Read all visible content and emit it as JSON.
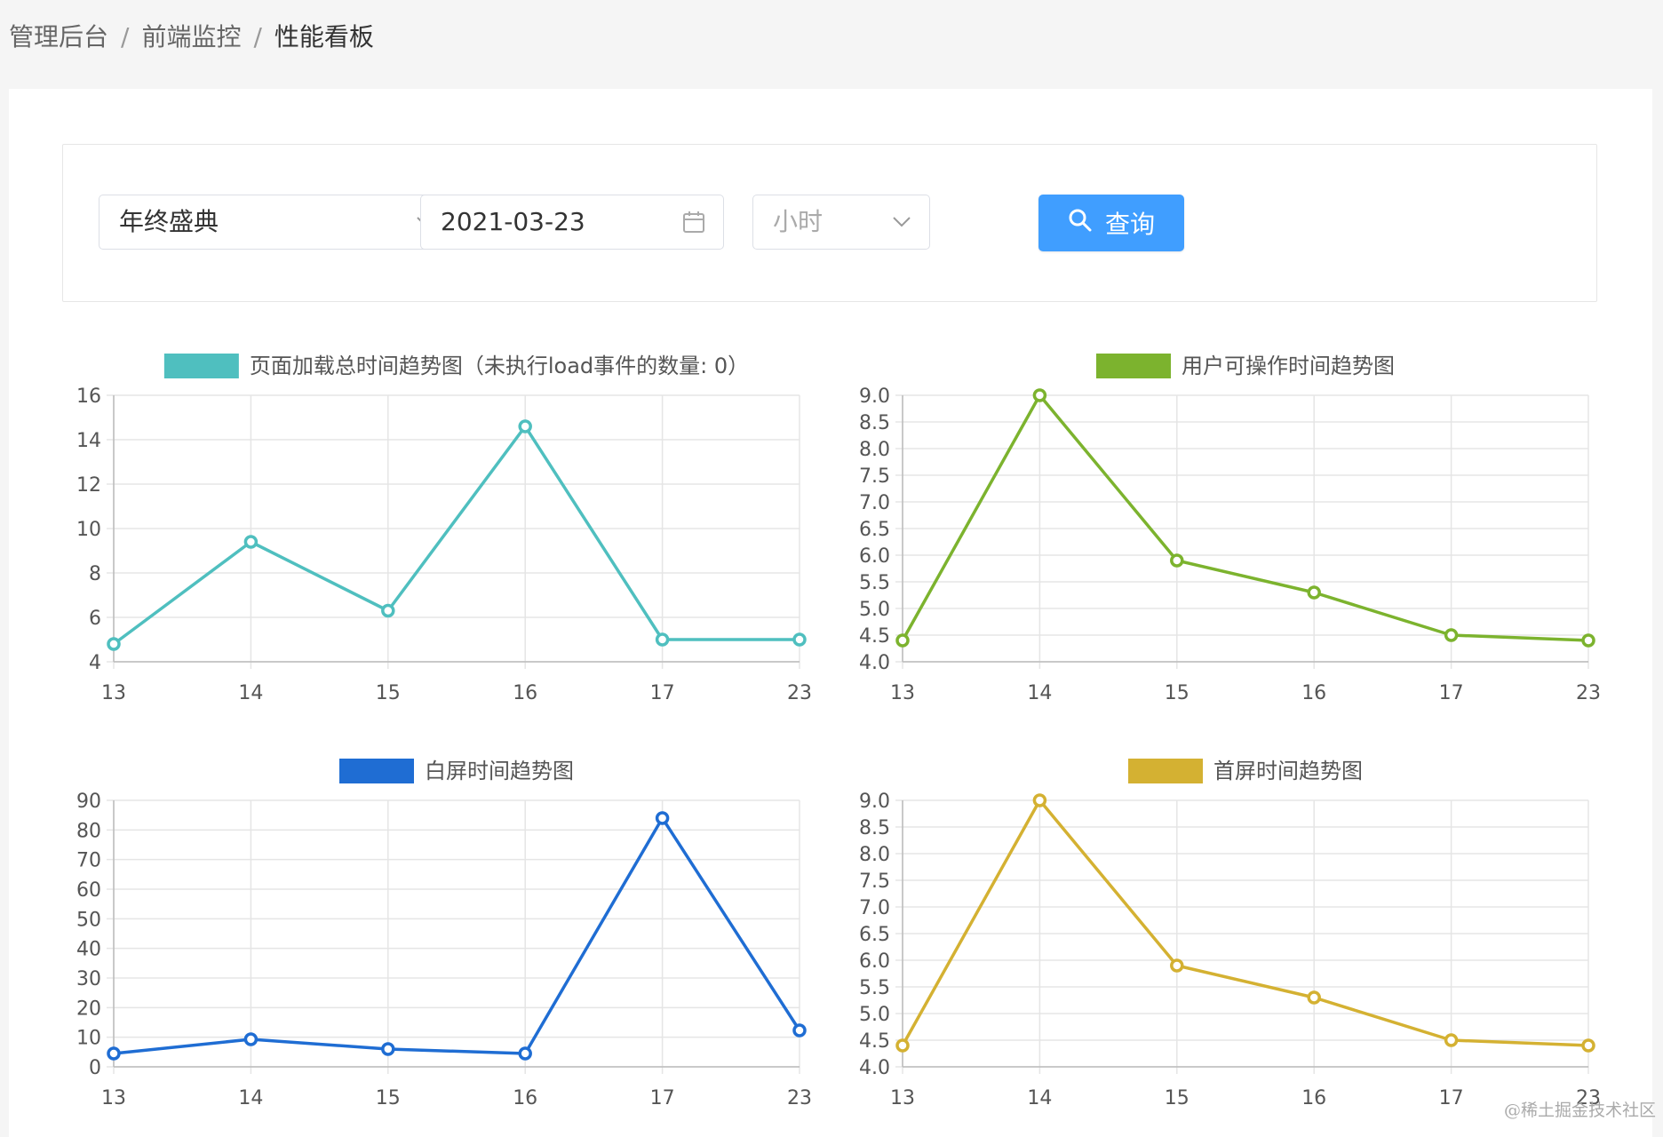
{
  "breadcrumb": {
    "items": [
      "管理后台",
      "前端监控",
      "性能看板"
    ],
    "separator": "/"
  },
  "filters": {
    "project_select": {
      "value": "年终盛典",
      "icon": "chevron-down-icon"
    },
    "date_picker": {
      "value": "2021-03-23",
      "icon": "calendar-icon"
    },
    "unit_select": {
      "placeholder": "小时",
      "icon": "chevron-down-icon"
    },
    "query_button": {
      "label": "查询",
      "icon": "search-icon",
      "color": "#409eff"
    }
  },
  "chart_data": [
    {
      "type": "line",
      "legend": "页面加载总时间趋势图（未执行load事件的数量: 0）",
      "color": "#4fbfbf",
      "categories": [
        "13",
        "14",
        "15",
        "16",
        "17",
        "23"
      ],
      "values": [
        4.8,
        9.4,
        6.3,
        14.6,
        5.0,
        5.0
      ],
      "ylim": [
        4,
        16
      ],
      "yticks": [
        "16",
        "14",
        "12",
        "10",
        "8",
        "6",
        "4"
      ],
      "grid": true,
      "legend_position": "top"
    },
    {
      "type": "line",
      "legend": "用户可操作时间趋势图",
      "color": "#7cb32e",
      "categories": [
        "13",
        "14",
        "15",
        "16",
        "17",
        "23"
      ],
      "values": [
        4.4,
        9.0,
        5.9,
        5.3,
        4.5,
        4.4
      ],
      "ylim": [
        4.0,
        9.0
      ],
      "yticks": [
        "9.0",
        "8.5",
        "8.0",
        "7.5",
        "7.0",
        "6.5",
        "6.0",
        "5.5",
        "5.0",
        "4.5",
        "4.0"
      ],
      "grid": true,
      "legend_position": "top"
    },
    {
      "type": "line",
      "legend": "白屏时间趋势图",
      "color": "#1f6dd3",
      "categories": [
        "13",
        "14",
        "15",
        "16",
        "17",
        "23"
      ],
      "values": [
        4.5,
        9.3,
        6.0,
        4.5,
        84.0,
        12.3
      ],
      "ylim": [
        0,
        90
      ],
      "yticks": [
        "90",
        "80",
        "70",
        "60",
        "50",
        "40",
        "30",
        "20",
        "10",
        "0"
      ],
      "grid": true,
      "legend_position": "top"
    },
    {
      "type": "line",
      "legend": "首屏时间趋势图",
      "color": "#d4b132",
      "categories": [
        "13",
        "14",
        "15",
        "16",
        "17",
        "23"
      ],
      "values": [
        4.4,
        9.0,
        5.9,
        5.3,
        4.5,
        4.4
      ],
      "ylim": [
        4.0,
        9.0
      ],
      "yticks": [
        "9.0",
        "8.5",
        "8.0",
        "7.5",
        "7.0",
        "6.5",
        "6.0",
        "5.5",
        "5.0",
        "4.5",
        "4.0"
      ],
      "grid": true,
      "legend_position": "top"
    }
  ],
  "watermark": "@稀土掘金技术社区"
}
